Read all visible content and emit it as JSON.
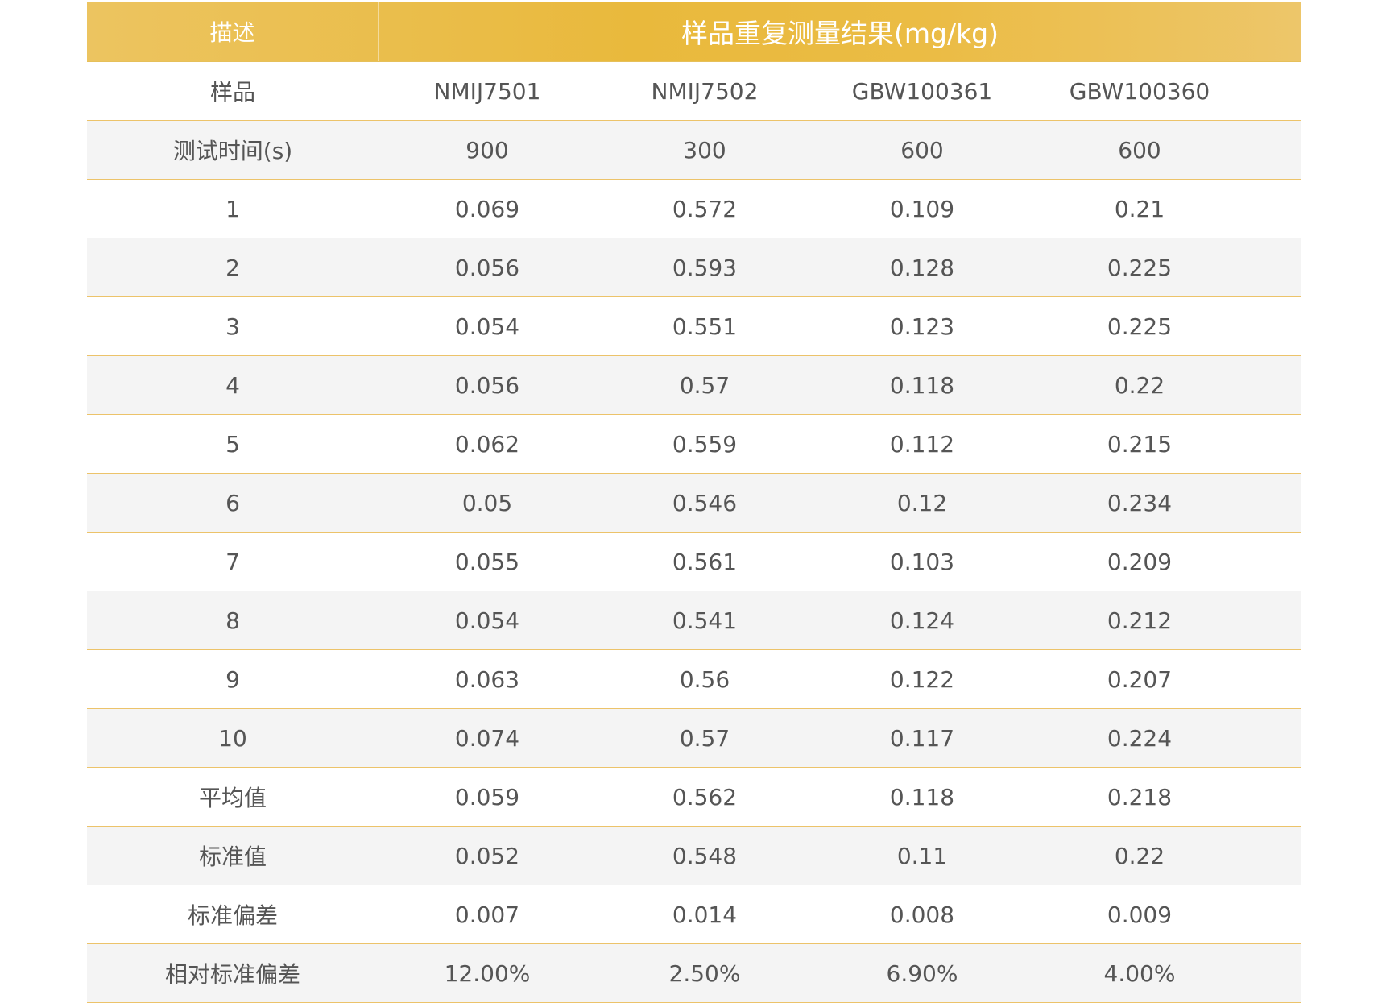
{
  "header": {
    "desc_label": "描述",
    "result_label": "样品重复测量结果(mg/kg)"
  },
  "rows": [
    {
      "label": "样品",
      "values": [
        "NMIJ7501",
        "NMIJ7502",
        "GBW100361",
        "GBW100360"
      ]
    },
    {
      "label": "测试时间(s)",
      "values": [
        "900",
        "300",
        "600",
        "600"
      ]
    },
    {
      "label": "1",
      "values": [
        "0.069",
        "0.572",
        "0.109",
        "0.21"
      ]
    },
    {
      "label": "2",
      "values": [
        "0.056",
        "0.593",
        "0.128",
        "0.225"
      ]
    },
    {
      "label": "3",
      "values": [
        "0.054",
        "0.551",
        "0.123",
        "0.225"
      ]
    },
    {
      "label": "4",
      "values": [
        "0.056",
        "0.57",
        "0.118",
        "0.22"
      ]
    },
    {
      "label": "5",
      "values": [
        "0.062",
        "0.559",
        "0.112",
        "0.215"
      ]
    },
    {
      "label": "6",
      "values": [
        "0.05",
        "0.546",
        "0.12",
        "0.234"
      ]
    },
    {
      "label": "7",
      "values": [
        "0.055",
        "0.561",
        "0.103",
        "0.209"
      ]
    },
    {
      "label": "8",
      "values": [
        "0.054",
        "0.541",
        "0.124",
        "0.212"
      ]
    },
    {
      "label": "9",
      "values": [
        "0.063",
        "0.56",
        "0.122",
        "0.207"
      ]
    },
    {
      "label": "10",
      "values": [
        "0.074",
        "0.57",
        "0.117",
        "0.224"
      ]
    },
    {
      "label": "平均值",
      "values": [
        "0.059",
        "0.562",
        "0.118",
        "0.218"
      ]
    },
    {
      "label": "标准值",
      "values": [
        "0.052",
        "0.548",
        "0.11",
        "0.22"
      ]
    },
    {
      "label": "标准偏差",
      "values": [
        "0.007",
        "0.014",
        "0.008",
        "0.009"
      ]
    },
    {
      "label": "相对标准偏差",
      "values": [
        "12.00%",
        "2.50%",
        "6.90%",
        "4.00%"
      ]
    }
  ],
  "colors": {
    "header_gold": "#e9b93c",
    "row_divider": "#ecc36a",
    "row_shade": "#f4f4f4",
    "text": "#555555"
  }
}
